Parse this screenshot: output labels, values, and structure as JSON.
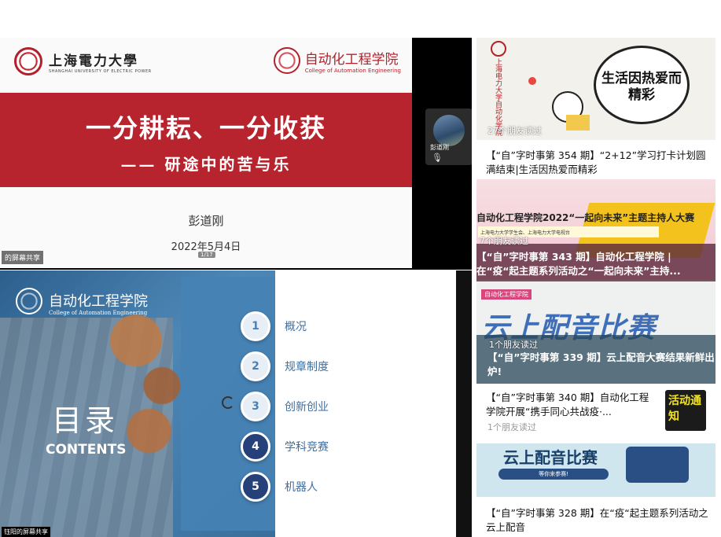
{
  "slide1": {
    "university": "上海電力大學",
    "university_en": "SHANGHAI UNIVERSITY OF ELECTRIC POWER",
    "college": "自动化工程学院",
    "college_en": "College of Automation Engineering",
    "title": "一分耕耘、一分收获",
    "subtitle": "—— 研途中的苦与乐",
    "author": "彭道刚",
    "date": "2022年5月4日",
    "page": "1/17",
    "share_label": "的屏幕共享"
  },
  "participant": {
    "name": "彭道刚"
  },
  "slide2": {
    "college": "自动化工程学院",
    "college_en": "College of Automation Engineering",
    "heading": "目录",
    "contents": "CONTENTS",
    "items": [
      {
        "num": "1",
        "label": "概况"
      },
      {
        "num": "2",
        "label": "规章制度"
      },
      {
        "num": "3",
        "label": "创新创业"
      },
      {
        "num": "4",
        "label": "学科竞赛"
      },
      {
        "num": "5",
        "label": "机器人"
      }
    ],
    "share_label": "钰阳的屏幕共享"
  },
  "feed": {
    "card1": {
      "badge_vertical": "上海电力大学自动化学院",
      "bubble": "生活因热爱而精彩",
      "reads": "27个朋友读过",
      "title": "【“自”字时事第 354 期】“2+12”学习打卡计划圆满结束|生活因热爱而精彩"
    },
    "card2": {
      "banner": "自动化工程学院2022“一起向未来”主题主持人大赛",
      "banner_sub": "上海电力大学学生会、上海电力大学电视台",
      "reads": "7个朋友读过",
      "title": "【“自”字时事第 343 期】自动化工程学院 | 在“疫“起主题系列活动之“一起向未来”主持..."
    },
    "card3": {
      "tag": "自动化工程学院",
      "art_title": "云上配音比赛",
      "reads": "1个朋友读过",
      "title": "【“自”字时事第 339 期】云上配音大赛结果新鲜出炉!"
    },
    "card4": {
      "title": "【“自”字时事第 340 期】自动化工程学院开展“携手同心共战疫·...",
      "reads": "1个朋友读过",
      "thumb_text": "活动通知"
    },
    "card5": {
      "art_title": "云上配音比赛",
      "art_button": "等你来参赛!",
      "title": "【“自”字时事第 328 期】在“疫“起主题系列活动之云上配音"
    }
  }
}
